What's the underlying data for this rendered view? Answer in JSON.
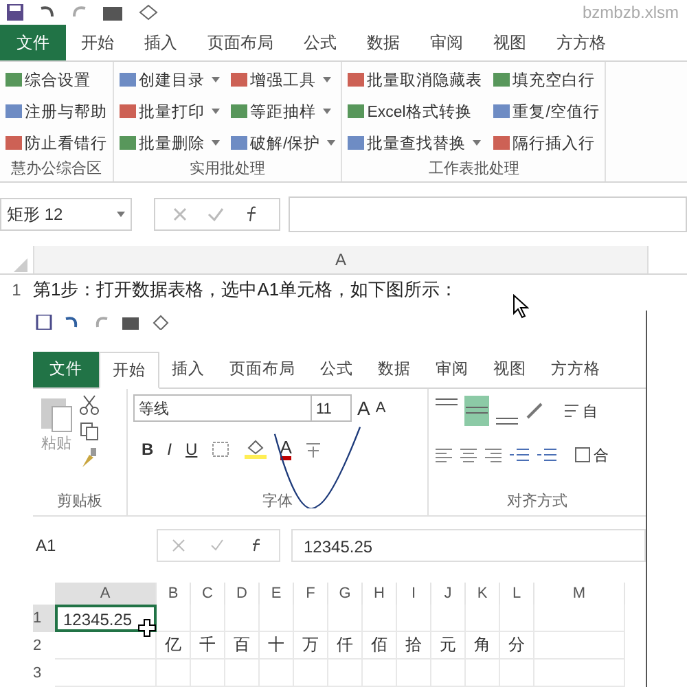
{
  "file_name": "bzmbzb.xlsm",
  "tabs": [
    {
      "label": "文件",
      "kind": "file",
      "selected": false
    },
    {
      "label": "开始",
      "kind": "tab",
      "selected": false
    },
    {
      "label": "插入",
      "kind": "tab",
      "selected": false
    },
    {
      "label": "页面布局",
      "kind": "tab",
      "selected": false
    },
    {
      "label": "公式",
      "kind": "tab",
      "selected": false
    },
    {
      "label": "数据",
      "kind": "tab",
      "selected": false
    },
    {
      "label": "审阅",
      "kind": "tab",
      "selected": false
    },
    {
      "label": "视图",
      "kind": "tab",
      "selected": false
    },
    {
      "label": "方方格",
      "kind": "tab",
      "selected": false
    }
  ],
  "ribbon_groups": [
    {
      "label": "慧办公综合区",
      "columns": [
        [
          {
            "label": "综合设置",
            "dropdown": false
          },
          {
            "label": "注册与帮助",
            "dropdown": false
          },
          {
            "label": "防止看错行",
            "dropdown": false
          }
        ]
      ]
    },
    {
      "label": "实用批处理",
      "columns": [
        [
          {
            "label": "创建目录",
            "dropdown": true
          },
          {
            "label": "批量打印",
            "dropdown": true
          },
          {
            "label": "批量删除",
            "dropdown": true
          }
        ],
        [
          {
            "label": "增强工具",
            "dropdown": true
          },
          {
            "label": "等距抽样",
            "dropdown": true
          },
          {
            "label": "破解/保护",
            "dropdown": true
          }
        ]
      ]
    },
    {
      "label": "工作表批处理",
      "columns": [
        [
          {
            "label": "批量取消隐藏表",
            "dropdown": false
          },
          {
            "label": "Excel格式转换",
            "dropdown": false
          },
          {
            "label": "批量查找替换",
            "dropdown": true
          }
        ],
        [
          {
            "label": "填充空白行",
            "dropdown": false
          },
          {
            "label": "重复/空值行",
            "dropdown": false
          },
          {
            "label": "隔行插入行",
            "dropdown": false
          }
        ]
      ]
    }
  ],
  "name_box": "矩形 12",
  "sheet": {
    "column": "A",
    "row": "1",
    "cell_text": "第1步：打开数据表格，选中A1单元格，如下图所示："
  },
  "inner": {
    "tabs": [
      {
        "label": "文件",
        "kind": "file",
        "selected": false
      },
      {
        "label": "开始",
        "kind": "tab",
        "selected": true
      },
      {
        "label": "插入",
        "kind": "tab",
        "selected": false
      },
      {
        "label": "页面布局",
        "kind": "tab",
        "selected": false
      },
      {
        "label": "公式",
        "kind": "tab",
        "selected": false
      },
      {
        "label": "数据",
        "kind": "tab",
        "selected": false
      },
      {
        "label": "审阅",
        "kind": "tab",
        "selected": false
      },
      {
        "label": "视图",
        "kind": "tab",
        "selected": false
      },
      {
        "label": "方方格",
        "kind": "tab",
        "selected": false
      }
    ],
    "paste_label": "粘贴",
    "font_name": "等线",
    "font_size": "11",
    "grow_font": "A",
    "shrink_font": "A",
    "format_buttons": [
      "B",
      "I",
      "U"
    ],
    "font_color": "A",
    "align_buttons": [
      {
        "selected": false
      },
      {
        "selected": true
      },
      {
        "selected": false
      }
    ],
    "wrap_label": "自",
    "merge_label": "合",
    "group_labels": [
      "剪贴板",
      "字体",
      "对齐方式"
    ],
    "name_box": "A1",
    "formula": "12345.25",
    "columns": [
      {
        "label": "A",
        "selected": true
      },
      {
        "label": "B",
        "selected": false
      },
      {
        "label": "C",
        "selected": false
      },
      {
        "label": "D",
        "selected": false
      },
      {
        "label": "E",
        "selected": false
      },
      {
        "label": "F",
        "selected": false
      },
      {
        "label": "G",
        "selected": false
      },
      {
        "label": "H",
        "selected": false
      },
      {
        "label": "I",
        "selected": false
      },
      {
        "label": "J",
        "selected": false
      },
      {
        "label": "K",
        "selected": false
      },
      {
        "label": "L",
        "selected": false
      },
      {
        "label": "M",
        "selected": false
      }
    ],
    "rows": [
      {
        "number": "1",
        "selected": true,
        "cells": [
          "12345.25",
          "",
          "",
          "",
          "",
          "",
          "",
          "",
          "",
          "",
          "",
          "",
          ""
        ]
      },
      {
        "number": "2",
        "selected": false,
        "cells": [
          "",
          "亿",
          "千",
          "百",
          "十",
          "万",
          "仟",
          "佰",
          "拾",
          "元",
          "角",
          "分",
          ""
        ]
      },
      {
        "number": "3",
        "selected": false,
        "cells": [
          "",
          "",
          "",
          "",
          "",
          "",
          "",
          "",
          "",
          "",
          "",
          "",
          ""
        ]
      }
    ]
  }
}
